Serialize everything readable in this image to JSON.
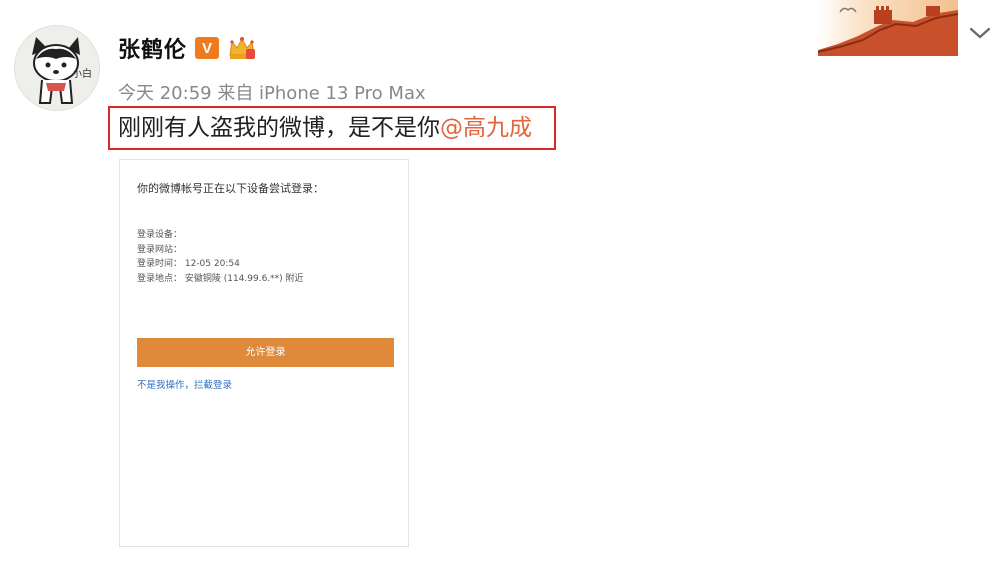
{
  "post": {
    "author": "张鹤伦",
    "meta": "今天 20:59 来自 iPhone 13 Pro Max",
    "text_main": "刚刚有人盗我的微博，是不是你",
    "mention": "@高九成",
    "avatar_label": "小白"
  },
  "badges": {
    "verified_letter": "V",
    "verified_color": "#f07b1e"
  },
  "icons": {
    "banner": "great-wall-banner",
    "expand": "chevron-down-icon",
    "crown": "crown-icon"
  },
  "card": {
    "title": "你的微博帐号正在以下设备尝试登录：",
    "device_label": "登录设备：",
    "site_label": "登录网站：",
    "time_line": "登录时间：  12-05 20:54",
    "location_line": "登录地点：  安徽铜陵 (114.99.6.**) 附近",
    "allow_label": "允许登录",
    "deny_label": "不是我操作，拦截登录",
    "button_color": "#df8a3a"
  },
  "colors": {
    "highlight_border": "#d62a2a",
    "mention": "#e2663c"
  }
}
